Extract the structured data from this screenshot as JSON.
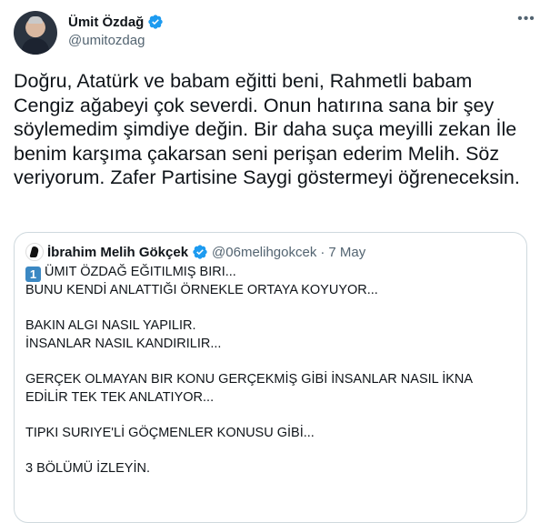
{
  "author": {
    "name": "Ümit Özdağ",
    "handle": "@umitozdag",
    "verified_icon": "verified-badge-icon",
    "more_icon": "more-options-icon"
  },
  "tweet": {
    "text": "Doğru, Atatürk ve babam eğitti beni, Rahmetli babam Cengiz ağabeyi çok severdi. Onun hatırına sana bir şey söylemedim şimdiye değin. Bir daha suça meyilli zekan İle benim karşıma çakarsan seni perişan ederim Melih. Söz veriyorum. Zafer Partisine Saygi göstermeyi öğreneceksin."
  },
  "quoted": {
    "name": "İbrahim Melih Gökçek",
    "handle": "@06melihgokcek",
    "separator": "·",
    "date": "7 May",
    "keycap": "1",
    "line1": "ÜMIT ÖZDAĞ EĞITILMIŞ BIRI...",
    "body": "BUNU KENDİ ANLATTIĞI ÖRNEKLE ORTAYA KOYUYOR...\n\nBAKIN ALGI NASIL YAPILIR.\nİNSANLAR NASIL KANDIRILIR...\n\nGERÇEK OLMAYAN BIR KONU GERÇEKMİŞ GİBİ İNSANLAR NASIL İKNA EDİLİR TEK TEK ANLATIYOR...\n\nTIPKI SURIYE'Lİ GÖÇMENLER KONUSU GİBİ...\n\n3 BÖLÜMÜ İZLEYİN."
  },
  "colors": {
    "accent": "#1d9bf0",
    "secondary_text": "#536471",
    "border": "#cfd9de"
  }
}
